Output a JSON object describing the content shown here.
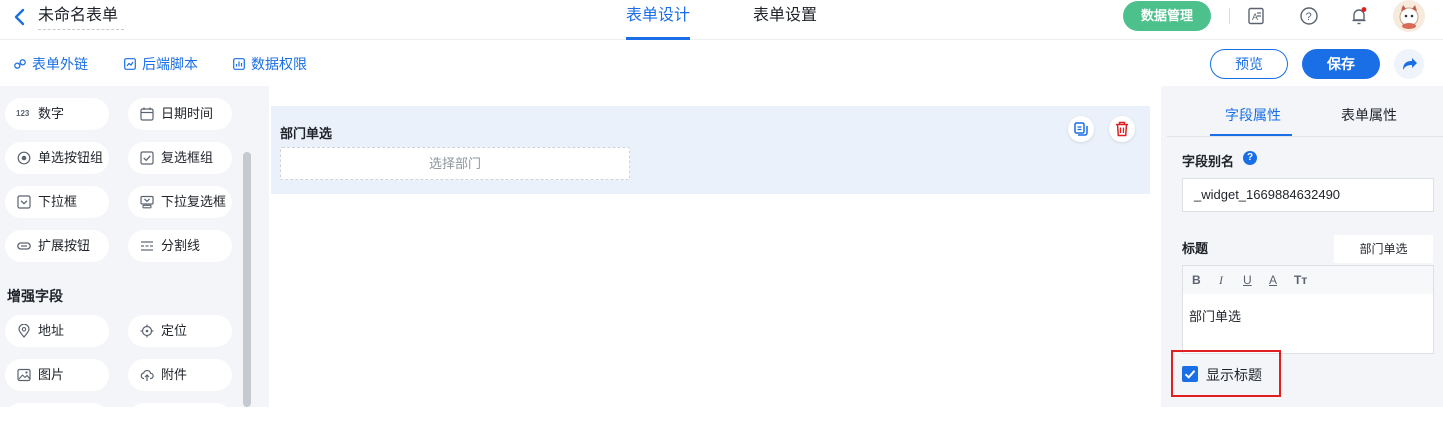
{
  "header": {
    "form_title": "未命名表单",
    "tabs": [
      {
        "label": "表单设计",
        "active": true
      },
      {
        "label": "表单设置",
        "active": false
      }
    ],
    "data_manage_label": "数据管理"
  },
  "toolbar": {
    "links": [
      {
        "label": "表单外链",
        "icon": "link-icon"
      },
      {
        "label": "后端脚本",
        "icon": "script-icon"
      },
      {
        "label": "数据权限",
        "icon": "permission-icon"
      }
    ],
    "preview_label": "预览",
    "save_label": "保存"
  },
  "widgets": {
    "basic": [
      {
        "label": "数字",
        "icon": "number-icon",
        "icon_text": "123"
      },
      {
        "label": "日期时间",
        "icon": "calendar-icon"
      },
      {
        "label": "单选按钮组",
        "icon": "radio-icon"
      },
      {
        "label": "复选框组",
        "icon": "checkbox-icon"
      },
      {
        "label": "下拉框",
        "icon": "dropdown-icon"
      },
      {
        "label": "下拉复选框",
        "icon": "dropdown-multi-icon"
      },
      {
        "label": "扩展按钮",
        "icon": "button-icon"
      },
      {
        "label": "分割线",
        "icon": "divider-icon"
      }
    ],
    "enhanced_title": "增强字段",
    "enhanced": [
      {
        "label": "地址",
        "icon": "location-pin-icon"
      },
      {
        "label": "定位",
        "icon": "crosshair-icon"
      },
      {
        "label": "图片",
        "icon": "image-icon"
      },
      {
        "label": "附件",
        "icon": "cloud-upload-icon"
      }
    ]
  },
  "canvas": {
    "field_label": "部门单选",
    "field_placeholder": "选择部门"
  },
  "properties": {
    "tabs": [
      {
        "label": "字段属性",
        "active": true
      },
      {
        "label": "表单属性",
        "active": false
      }
    ],
    "alias_label": "字段别名",
    "alias_value": "_widget_1669884632490",
    "title_label": "标题",
    "title_tag": "部门单选",
    "format_buttons": [
      "B",
      "I",
      "U",
      "A",
      "Tт"
    ],
    "title_text": "部门单选",
    "show_title_label": "显示标题",
    "show_title_checked": true
  },
  "colors": {
    "accent": "#1a6fe6",
    "data_button": "#4cc18b",
    "danger": "#e02020"
  }
}
